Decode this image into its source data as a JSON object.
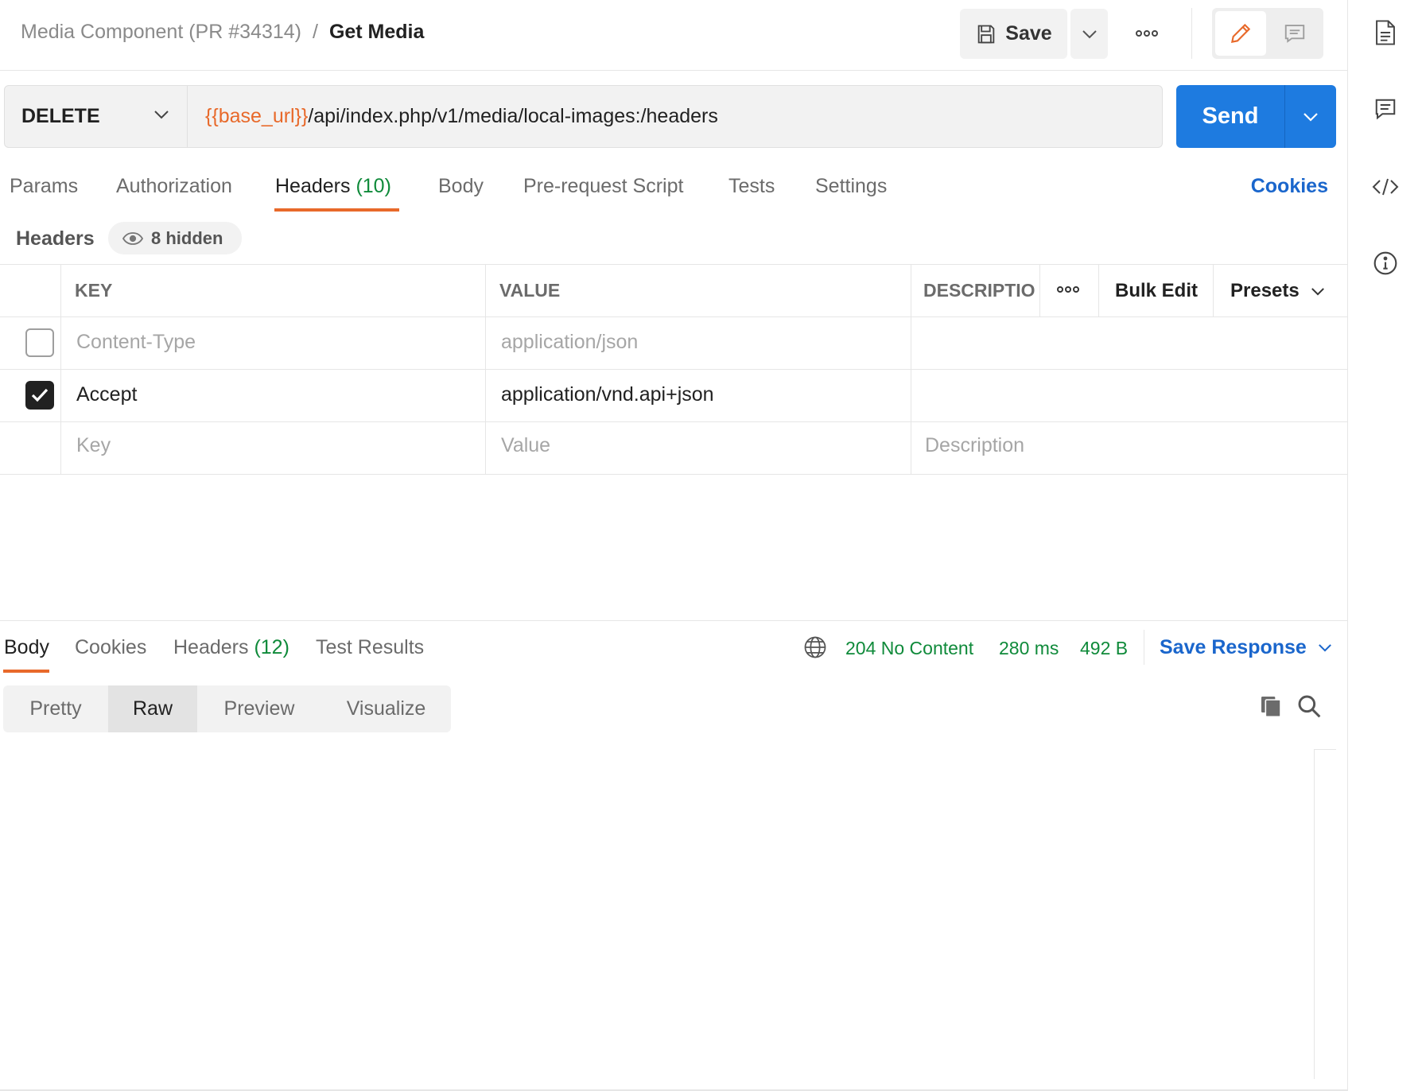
{
  "breadcrumb": {
    "parent": "Media Component (PR #34314)",
    "separator": "/",
    "current": "Get Media"
  },
  "toolbar": {
    "save_label": "Save"
  },
  "request": {
    "method": "DELETE",
    "url_variable": "{{base_url}}",
    "url_path": "/api/index.php/v1/media/local-images:/headers",
    "send_label": "Send"
  },
  "tabs": {
    "params": "Params",
    "authorization": "Authorization",
    "headers": "Headers",
    "headers_count": "(10)",
    "body": "Body",
    "prerequest": "Pre-request Script",
    "tests": "Tests",
    "settings": "Settings",
    "cookies": "Cookies"
  },
  "headers_section": {
    "title": "Headers",
    "hidden_label": "8 hidden"
  },
  "table": {
    "columns": {
      "key": "KEY",
      "value": "VALUE",
      "description": "DESCRIPTIO",
      "bulk_edit": "Bulk Edit",
      "presets": "Presets"
    },
    "rows": [
      {
        "key": "Content-Type",
        "value": "application/json",
        "checked": false
      },
      {
        "key": "Accept",
        "value": "application/vnd.api+json",
        "checked": true
      }
    ],
    "placeholders": {
      "key": "Key",
      "value": "Value",
      "description": "Description"
    }
  },
  "response": {
    "tabs": {
      "body": "Body",
      "cookies": "Cookies",
      "headers": "Headers",
      "headers_count": "(12)",
      "test_results": "Test Results"
    },
    "status": "204 No Content",
    "time": "280 ms",
    "size": "492 B",
    "save_response": "Save Response",
    "views": {
      "pretty": "Pretty",
      "raw": "Raw",
      "preview": "Preview",
      "visualize": "Visualize"
    }
  },
  "colors": {
    "accent_orange": "#e8692a",
    "send_blue": "#1e7be0",
    "link_blue": "#1a66cc",
    "success_green": "#0f8a3a"
  }
}
